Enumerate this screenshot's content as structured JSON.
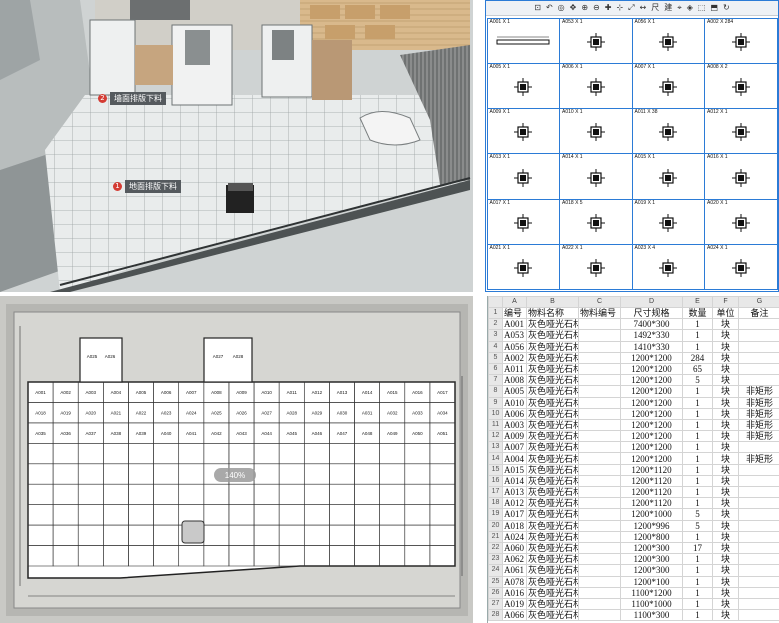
{
  "view3d": {
    "tags": [
      {
        "num": "2",
        "label": "墙面排版下料"
      },
      {
        "num": "1",
        "label": "地面排版下料"
      }
    ]
  },
  "cad": {
    "toolbar": [
      "⊡",
      "↶",
      "◎",
      "✥",
      "⊕",
      "⊖",
      "✚",
      "⊹",
      "⤢",
      "↔",
      "尺",
      "建",
      "⌖",
      "◈",
      "⬚",
      "⬒",
      "↻"
    ],
    "cells": [
      {
        "title": "A001 X 1",
        "foot": "",
        "shape": "bar"
      },
      {
        "title": "A053 X 1",
        "foot": "",
        "shape": "tile"
      },
      {
        "title": "A056 X 1",
        "foot": "",
        "shape": "tile"
      },
      {
        "title": "A002 X 284",
        "foot": "",
        "shape": "tile"
      },
      {
        "title": "A005 X 1",
        "foot": "",
        "shape": "tile"
      },
      {
        "title": "A006 X 1",
        "foot": "",
        "shape": "tile"
      },
      {
        "title": "A007 X 1",
        "foot": "",
        "shape": "tile"
      },
      {
        "title": "A008 X 2",
        "foot": "",
        "shape": "tile"
      },
      {
        "title": "A009 X 1",
        "foot": "",
        "shape": "tile"
      },
      {
        "title": "A010 X 1",
        "foot": "",
        "shape": "tile"
      },
      {
        "title": "A011 X 38",
        "foot": "",
        "shape": "tile"
      },
      {
        "title": "A012 X 1",
        "foot": "",
        "shape": "tile"
      },
      {
        "title": "A013 X 1",
        "foot": "",
        "shape": "tile"
      },
      {
        "title": "A014 X 1",
        "foot": "",
        "shape": "tile"
      },
      {
        "title": "A015 X 1",
        "foot": "",
        "shape": "tile"
      },
      {
        "title": "A016 X 1",
        "foot": "",
        "shape": "tile"
      },
      {
        "title": "A017 X 1",
        "foot": "",
        "shape": "tile"
      },
      {
        "title": "A018 X 5",
        "foot": "",
        "shape": "tile"
      },
      {
        "title": "A019 X 1",
        "foot": "",
        "shape": "tile"
      },
      {
        "title": "A020 X 1",
        "foot": "",
        "shape": "tile"
      },
      {
        "title": "A021 X 1",
        "foot": "",
        "shape": "tile"
      },
      {
        "title": "A022 X 1",
        "foot": "",
        "shape": "tile"
      },
      {
        "title": "A023 X 4",
        "foot": "",
        "shape": "tile"
      },
      {
        "title": "A024 X 1",
        "foot": "",
        "shape": "tile"
      }
    ]
  },
  "plan": {
    "zoom_label": "140%",
    "rows": [
      [
        "A001",
        "A002",
        "A003",
        "A004",
        "A005",
        "A006",
        "A007",
        "A008",
        "A009",
        "A010",
        "A011",
        "A012",
        "A013",
        "A014",
        "A015",
        "A016",
        "A017"
      ],
      [
        "A018",
        "A019",
        "A020",
        "A021",
        "A022",
        "A023",
        "A024",
        "A025",
        "A026",
        "A027",
        "A028",
        "A029",
        "A030",
        "A031",
        "A032",
        "A033",
        "A034"
      ],
      [
        "A035",
        "A036",
        "A037",
        "A038",
        "A039",
        "A040",
        "A041",
        "A042",
        "A043",
        "A044",
        "A045",
        "A046",
        "A047",
        "A048",
        "A049",
        "A050",
        "A051"
      ]
    ],
    "top_labels": [
      "A025",
      "A026",
      "A027",
      "A028"
    ]
  },
  "sheet": {
    "col_letters": [
      "A",
      "B",
      "C",
      "D",
      "E",
      "F",
      "G"
    ],
    "header": [
      "编号",
      "物料名称",
      "物料编号",
      "尺寸规格",
      "数量",
      "单位",
      "备注"
    ],
    "rows": [
      [
        "A001",
        "灰色哑光石材",
        "",
        "7400*300",
        "1",
        "块",
        ""
      ],
      [
        "A053",
        "灰色哑光石材",
        "",
        "1492*330",
        "1",
        "块",
        ""
      ],
      [
        "A056",
        "灰色哑光石材",
        "",
        "1410*330",
        "1",
        "块",
        ""
      ],
      [
        "A002",
        "灰色哑光石材",
        "",
        "1200*1200",
        "284",
        "块",
        ""
      ],
      [
        "A011",
        "灰色哑光石材",
        "",
        "1200*1200",
        "65",
        "块",
        ""
      ],
      [
        "A008",
        "灰色哑光石材",
        "",
        "1200*1200",
        "5",
        "块",
        ""
      ],
      [
        "A005",
        "灰色哑光石材",
        "",
        "1200*1200",
        "1",
        "块",
        "非矩形"
      ],
      [
        "A010",
        "灰色哑光石材",
        "",
        "1200*1200",
        "1",
        "块",
        "非矩形"
      ],
      [
        "A006",
        "灰色哑光石材",
        "",
        "1200*1200",
        "1",
        "块",
        "非矩形"
      ],
      [
        "A003",
        "灰色哑光石材",
        "",
        "1200*1200",
        "1",
        "块",
        "非矩形"
      ],
      [
        "A009",
        "灰色哑光石材",
        "",
        "1200*1200",
        "1",
        "块",
        "非矩形"
      ],
      [
        "A007",
        "灰色哑光石材",
        "",
        "1200*1200",
        "1",
        "块",
        ""
      ],
      [
        "A004",
        "灰色哑光石材",
        "",
        "1200*1200",
        "1",
        "块",
        "非矩形"
      ],
      [
        "A015",
        "灰色哑光石材",
        "",
        "1200*1120",
        "1",
        "块",
        ""
      ],
      [
        "A014",
        "灰色哑光石材",
        "",
        "1200*1120",
        "1",
        "块",
        ""
      ],
      [
        "A013",
        "灰色哑光石材",
        "",
        "1200*1120",
        "1",
        "块",
        ""
      ],
      [
        "A012",
        "灰色哑光石材",
        "",
        "1200*1120",
        "1",
        "块",
        ""
      ],
      [
        "A017",
        "灰色哑光石材",
        "",
        "1200*1000",
        "5",
        "块",
        ""
      ],
      [
        "A018",
        "灰色哑光石材",
        "",
        "1200*996",
        "5",
        "块",
        ""
      ],
      [
        "A024",
        "灰色哑光石材",
        "",
        "1200*800",
        "1",
        "块",
        ""
      ],
      [
        "A060",
        "灰色哑光石材",
        "",
        "1200*300",
        "17",
        "块",
        ""
      ],
      [
        "A062",
        "灰色哑光石材",
        "",
        "1200*300",
        "1",
        "块",
        ""
      ],
      [
        "A061",
        "灰色哑光石材",
        "",
        "1200*300",
        "1",
        "块",
        ""
      ],
      [
        "A078",
        "灰色哑光石材",
        "",
        "1200*100",
        "1",
        "块",
        ""
      ],
      [
        "A016",
        "灰色哑光石材",
        "",
        "1100*1200",
        "1",
        "块",
        ""
      ],
      [
        "A019",
        "灰色哑光石材",
        "",
        "1100*1000",
        "1",
        "块",
        ""
      ],
      [
        "A066",
        "灰色哑光石材",
        "",
        "1100*300",
        "1",
        "块",
        ""
      ]
    ]
  }
}
